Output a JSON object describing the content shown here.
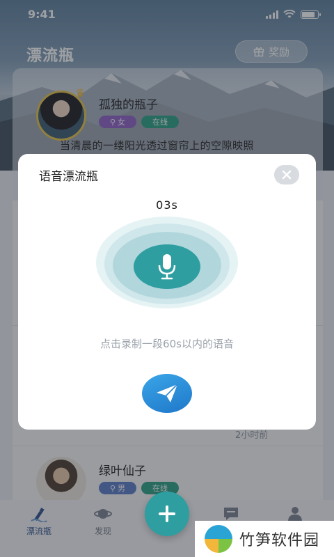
{
  "status": {
    "time": "9:41"
  },
  "header": {
    "title": "漂流瓶",
    "reward_label": "奖励"
  },
  "bottles": [
    {
      "username": "孤独的瓶子",
      "gender": "女",
      "online": "在线",
      "message": "当清晨的一缕阳光透过窗帘上的空隙映照"
    },
    {
      "time_ago": "2小时前"
    },
    {
      "username": "绿叶仙子",
      "gender": "男",
      "online": "在线"
    }
  ],
  "voice_dialog": {
    "title": "语音漂流瓶",
    "counter": "03s",
    "hint": "点击录制一段60s以内的语音"
  },
  "tabs": [
    {
      "label": "漂流瓶",
      "icon": "bottle-icon",
      "active": true
    },
    {
      "label": "发现",
      "icon": "planet-icon",
      "active": false
    },
    {
      "label": "",
      "icon": "chat-icon",
      "active": false
    },
    {
      "label": "",
      "icon": "person-icon",
      "active": false
    }
  ],
  "watermark": {
    "text": "竹笋软件园"
  },
  "colors": {
    "accent": "#2f9ea1",
    "female_tag": "#8e5fc9",
    "male_tag": "#5a7bc8",
    "online_tag": "#29a185",
    "send": "#1f78c9"
  }
}
